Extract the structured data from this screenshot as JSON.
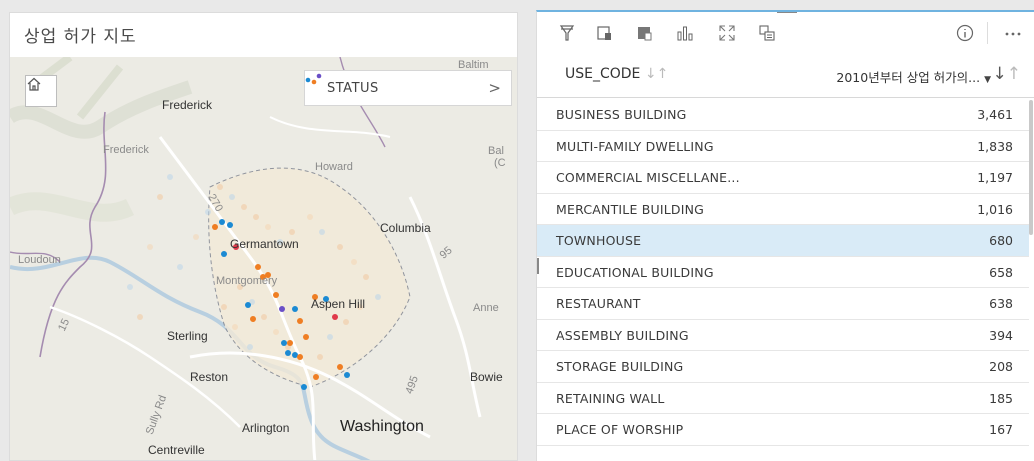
{
  "map": {
    "title": "상업 허가 지도",
    "legend_label": "STATUS",
    "legend_chevron": ">",
    "places": [
      {
        "name": "Baltim",
        "kind": "minor"
      },
      {
        "name": "Frederick",
        "kind": "normal"
      },
      {
        "name": "Frederick",
        "kind": "minor"
      },
      {
        "name": "Bal",
        "kind": "minor"
      },
      {
        "name": "(C",
        "kind": "minor"
      },
      {
        "name": "Howard",
        "kind": "minor"
      },
      {
        "name": "270",
        "kind": "minor"
      },
      {
        "name": "Columbia",
        "kind": "normal"
      },
      {
        "name": "Germantown",
        "kind": "normal"
      },
      {
        "name": "Loudoun",
        "kind": "minor"
      },
      {
        "name": "95",
        "kind": "minor"
      },
      {
        "name": "Montgomery",
        "kind": "minor"
      },
      {
        "name": "Aspen Hill",
        "kind": "normal"
      },
      {
        "name": "Anne",
        "kind": "minor"
      },
      {
        "name": "15",
        "kind": "minor"
      },
      {
        "name": "Sterling",
        "kind": "normal"
      },
      {
        "name": "Reston",
        "kind": "normal"
      },
      {
        "name": "495",
        "kind": "minor"
      },
      {
        "name": "Bowie",
        "kind": "normal"
      },
      {
        "name": "Sully Rd",
        "kind": "minor"
      },
      {
        "name": "Arlington",
        "kind": "normal"
      },
      {
        "name": "Washington",
        "kind": "major"
      },
      {
        "name": "Centreville",
        "kind": "normal"
      }
    ]
  },
  "table": {
    "col1_header": "USE_CODE",
    "col2_header": "2010년부터 상업 허가의...",
    "rows": [
      {
        "code": "BUSINESS BUILDING",
        "count": "3,461"
      },
      {
        "code": "MULTI-FAMILY DWELLING",
        "count": "1,838"
      },
      {
        "code": "COMMERCIAL MISCELLANE...",
        "count": "1,197"
      },
      {
        "code": "MERCANTILE BUILDING",
        "count": "1,016"
      },
      {
        "code": "TOWNHOUSE",
        "count": "680",
        "selected": true
      },
      {
        "code": "EDUCATIONAL BUILDING",
        "count": "658"
      },
      {
        "code": "RESTAURANT",
        "count": "638"
      },
      {
        "code": "ASSEMBLY BUILDING",
        "count": "394"
      },
      {
        "code": "STORAGE BUILDING",
        "count": "208"
      },
      {
        "code": "RETAINING WALL",
        "count": "185"
      },
      {
        "code": "PLACE OF WORSHIP",
        "count": "167"
      },
      {
        "code": "",
        "count": ""
      }
    ]
  },
  "colors": {
    "accent": "#6fb3e0",
    "selected_row": "#d9ebf7",
    "status_blue": "#1b8ad3",
    "status_orange": "#ef7e23",
    "status_purple": "#6a4fc7",
    "status_red": "#e0394a"
  },
  "icons": [
    "filter-icon",
    "card-flip-icon",
    "card-view-icon",
    "chart-type-icon",
    "maximize-icon",
    "duplicate-icon",
    "info-icon",
    "more-icon",
    "home-icon"
  ]
}
